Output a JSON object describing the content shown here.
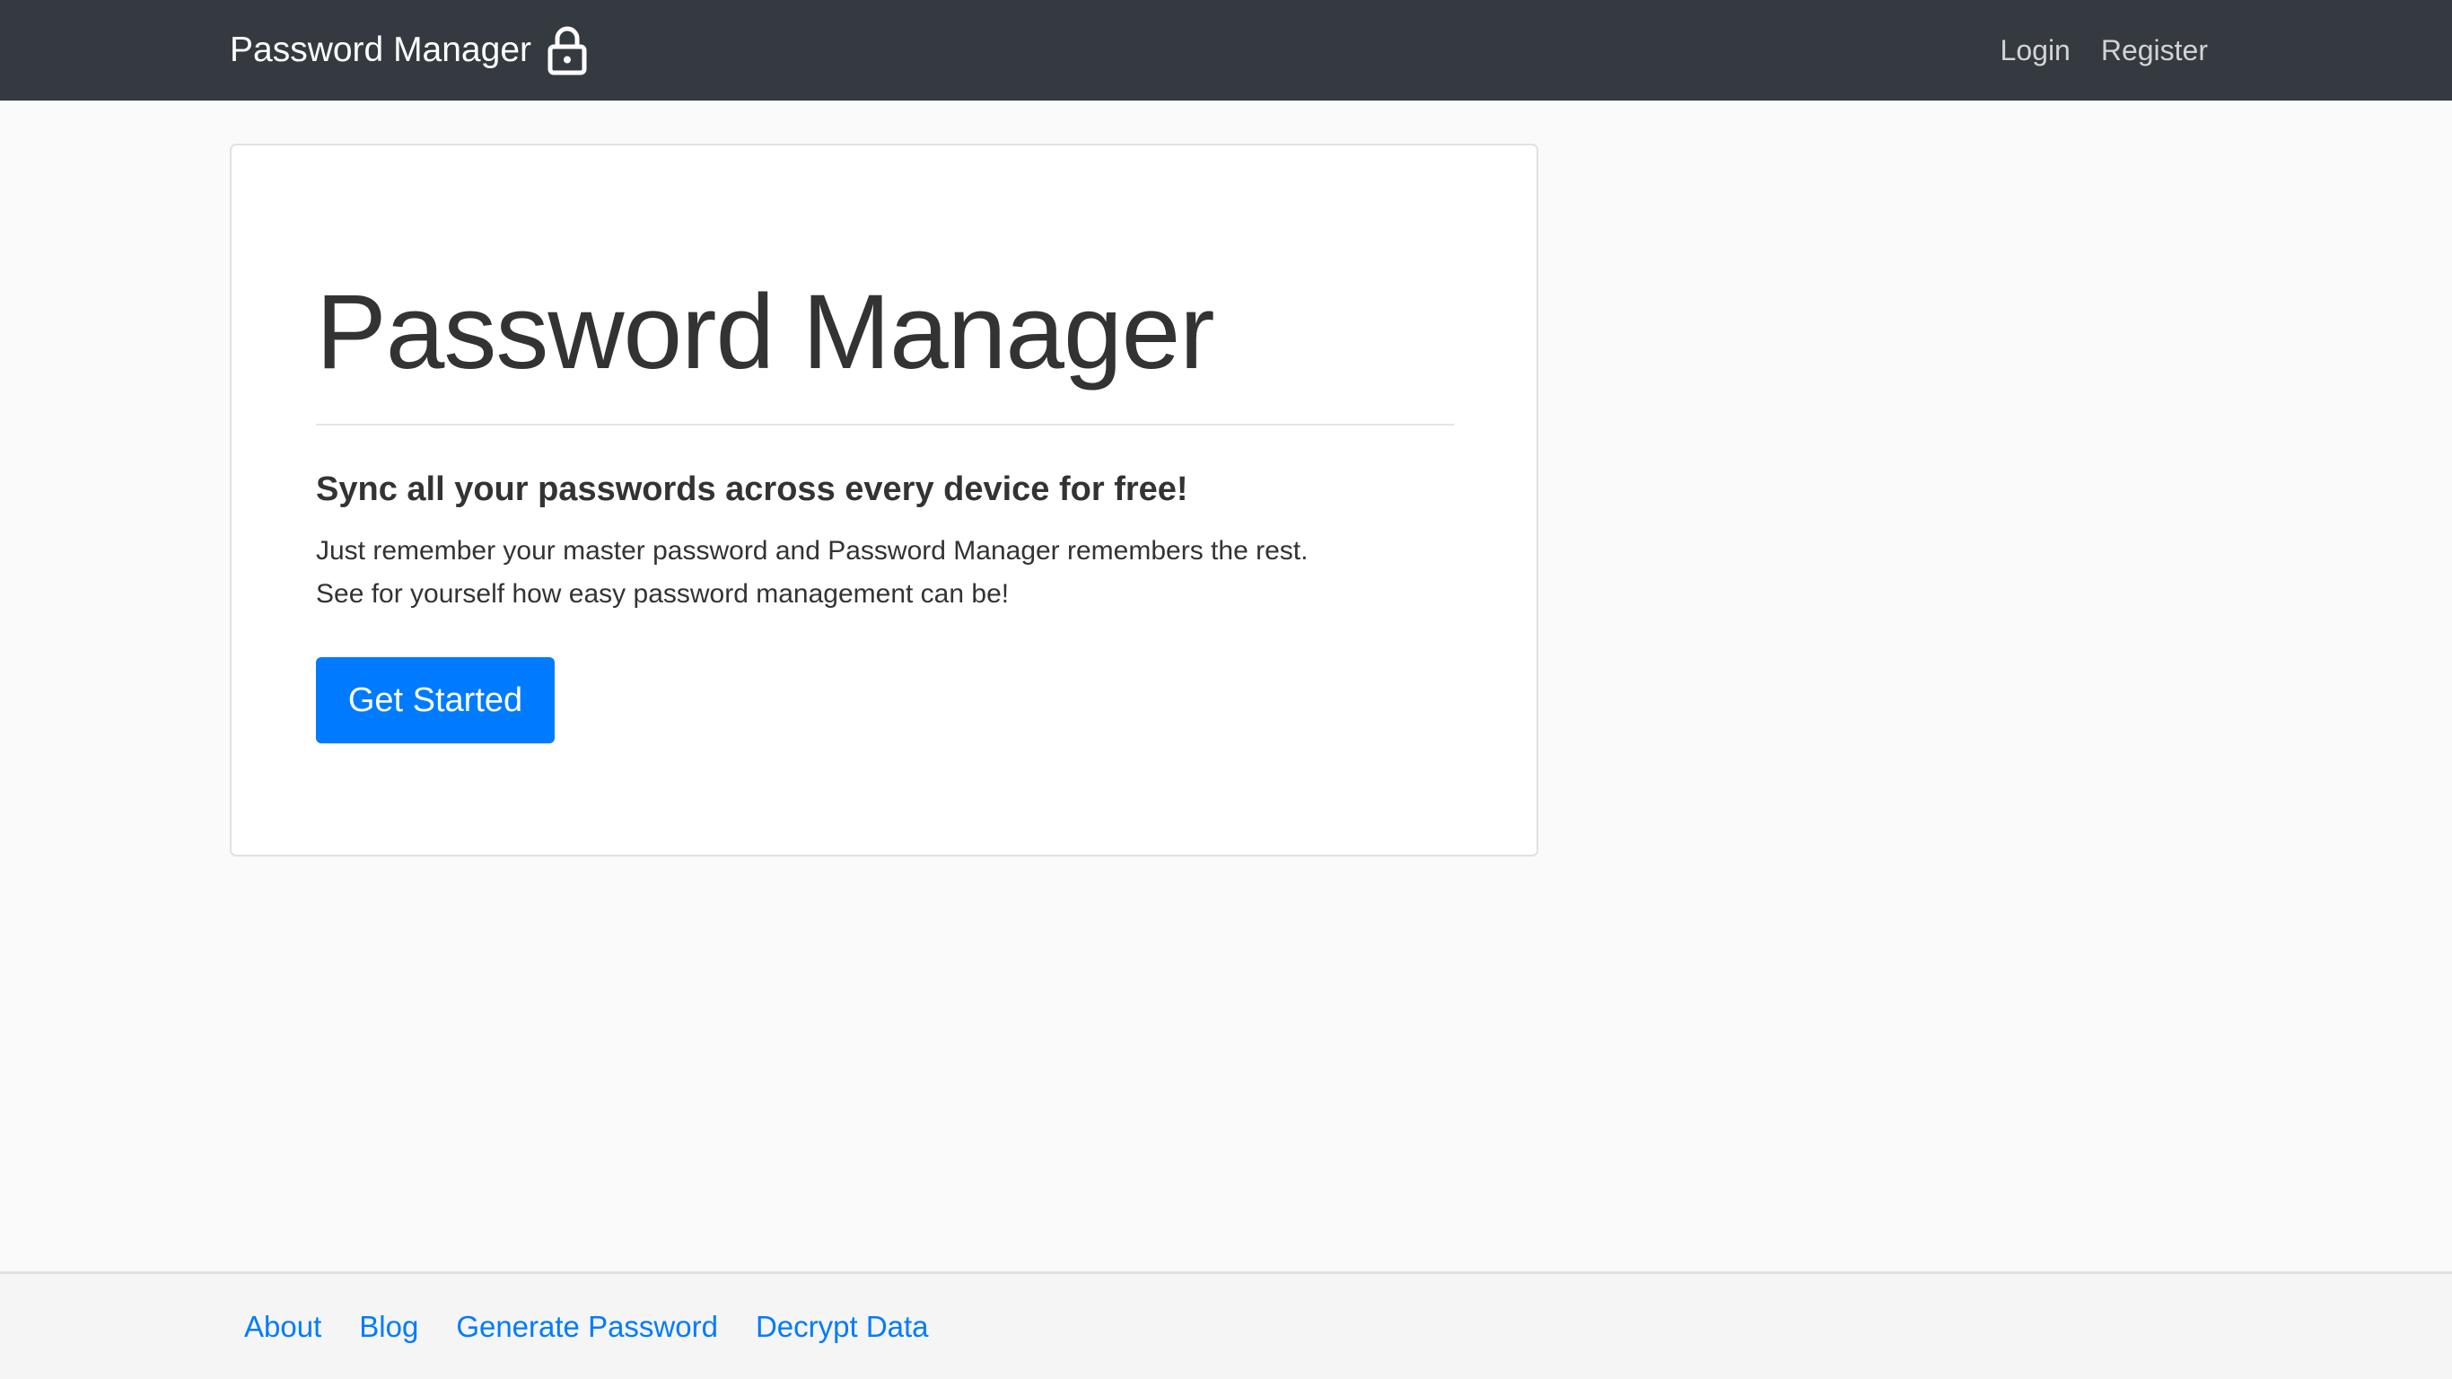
{
  "navbar": {
    "brand": "Password Manager",
    "brand_icon": "lock-icon",
    "links": [
      {
        "label": "Login"
      },
      {
        "label": "Register"
      }
    ]
  },
  "hero": {
    "title": "Password Manager",
    "subtitle": "Sync all your passwords across every device for free!",
    "lines": [
      "Just remember your master password and Password Manager remembers the rest.",
      "See for yourself how easy password management can be!"
    ],
    "button_label": "Get Started"
  },
  "footer": {
    "links": [
      {
        "label": "About"
      },
      {
        "label": "Blog"
      },
      {
        "label": "Generate Password"
      },
      {
        "label": "Decrypt Data"
      }
    ]
  },
  "colors": {
    "navbar": "#343a40",
    "primary": "#007bff",
    "background": "#fafafa"
  }
}
